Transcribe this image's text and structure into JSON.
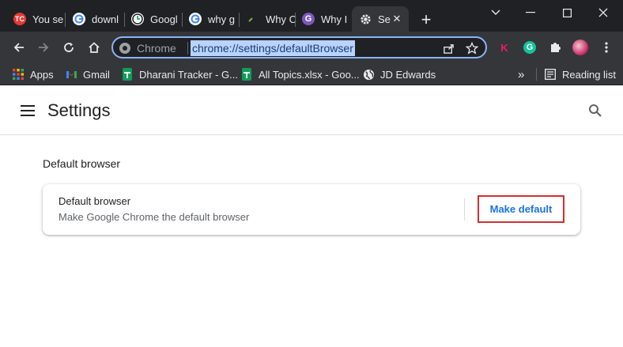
{
  "window": {
    "colors": {
      "tabstrip": "#202124",
      "toolbar": "#35363a",
      "accent": "#8ab4f8"
    }
  },
  "tabs": [
    {
      "title": "You se",
      "icon": "tc-favicon",
      "active": false
    },
    {
      "title": "downl",
      "icon": "google-favicon",
      "active": false
    },
    {
      "title": "Googl",
      "icon": "clock-favicon",
      "active": false
    },
    {
      "title": "why g",
      "icon": "google-favicon",
      "active": false
    },
    {
      "title": "Why C",
      "icon": "check-favicon",
      "active": false
    },
    {
      "title": "Why I",
      "icon": "grammarly-favicon",
      "active": false
    },
    {
      "title": "Se",
      "icon": "gear-icon",
      "active": true
    }
  ],
  "omnibox": {
    "chip": "Chrome",
    "url": "chrome://settings/defaultBrowser"
  },
  "extensions": [
    {
      "icon": "k-extension-icon",
      "label": "K"
    },
    {
      "icon": "grammarly-extension-icon",
      "label": "G"
    }
  ],
  "bookmarks": {
    "items": [
      {
        "label": "Apps",
        "icon": "apps-grid-icon"
      },
      {
        "label": "Gmail",
        "icon": "gmail-icon"
      },
      {
        "label": "Dharani Tracker - G...",
        "icon": "sheets-icon"
      },
      {
        "label": "All Topics.xlsx - Goo...",
        "icon": "sheets-icon"
      },
      {
        "label": "JD Edwards",
        "icon": "globe-icon"
      }
    ],
    "overflow": "»",
    "reading_list": "Reading list"
  },
  "settings": {
    "title": "Settings",
    "section_title": "Default browser",
    "card": {
      "label": "Default browser",
      "sublabel": "Make Google Chrome the default browser",
      "button": "Make default"
    },
    "colors": {
      "button_text": "#1a73e8",
      "highlight_box": "#d32f2f"
    }
  }
}
